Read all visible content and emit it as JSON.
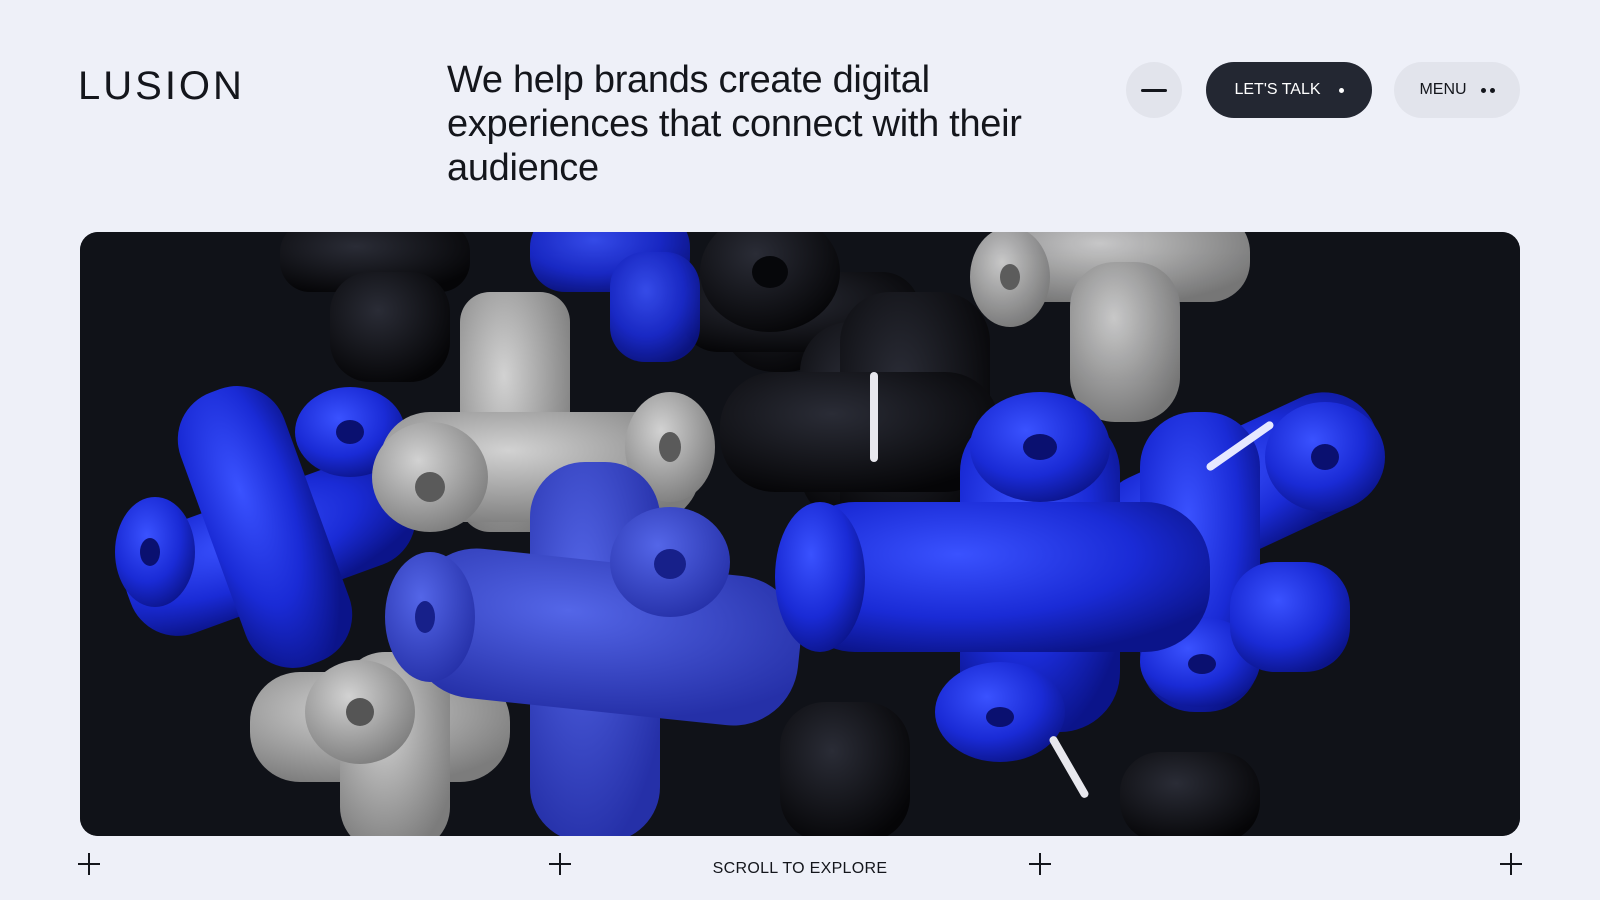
{
  "header": {
    "logo": "LUSION",
    "tagline": "We help brands create digital experiences that connect with their audience",
    "minus_button_icon": "minus-icon",
    "talk_button_label": "LET'S TALK",
    "menu_button_label": "MENU"
  },
  "hero": {
    "image_description_icon": "3d-jack-shapes-artwork",
    "colors": {
      "background": "#101218",
      "blue": "#1d2fe0",
      "grey": "#a9a9a9",
      "black": "#0a0b10"
    }
  },
  "footer": {
    "scroll_label": "SCROLL TO EXPLORE",
    "plus_icon": "plus-icon"
  },
  "colors": {
    "page_bg": "#eef0f8",
    "dark_button": "#232732",
    "light_button": "#e2e4ec"
  }
}
